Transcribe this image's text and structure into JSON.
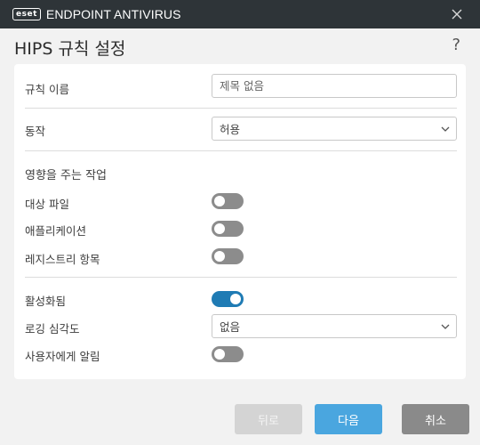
{
  "window": {
    "logo_text": "eset",
    "product_name": "ENDPOINT ANTIVIRUS",
    "title": "HIPS 규칙 설정",
    "help": "?"
  },
  "form": {
    "rule_name_label": "규칙 이름",
    "rule_name_placeholder": "제목 없음",
    "action_label": "동작",
    "action_value": "허용",
    "affects_heading": "영향을 주는 작업",
    "affects": [
      {
        "label": "대상 파일",
        "on": false
      },
      {
        "label": "애플리케이션",
        "on": false
      },
      {
        "label": "레지스트리 항목",
        "on": false
      }
    ],
    "enabled_label": "활성화됨",
    "enabled_on": true,
    "logging_label": "로깅 심각도",
    "logging_value": "없음",
    "notify_label": "사용자에게 알림",
    "notify_on": false
  },
  "buttons": {
    "back": "뒤로",
    "next": "다음",
    "cancel": "취소"
  },
  "colors": {
    "titlebar": "#2e3438",
    "toggle_on": "#1f7bb4",
    "toggle_off": "#8c8c8c",
    "next_button": "#4aa6df",
    "cancel_button": "#8a8a8a",
    "back_button_disabled": "#d4d4d4"
  }
}
